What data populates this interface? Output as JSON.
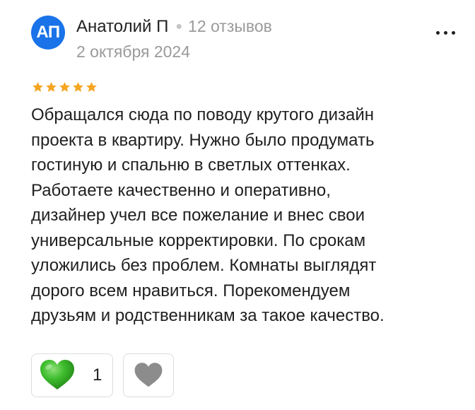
{
  "review": {
    "avatar_initials": "АП",
    "author_name": "Анатолий П",
    "reviews_count": "12 отзывов",
    "date": "2 октября 2024",
    "rating": 5,
    "rating_max": 5,
    "text_lines": [
      "Обращался сюда по поводу крутого дизайн",
      "проекта в квартиру. Нужно было продумать",
      "гостиную и спальню в светлых оттенках.",
      "Работаете качественно и оперативно,",
      "дизайнер учел все пожелание и внес свои",
      "универсальные корректировки. По срокам",
      "уложились без проблем. Комнаты выглядят",
      "дорого всем нравиться. Порекомендуем",
      "друзьям и родственникам за такое качество."
    ],
    "likes": "1"
  },
  "colors": {
    "avatar_bg": "#1a73e8",
    "star": "#f5a623",
    "like_heart": "#3dbb2c",
    "dislike_heart": "#8c8c8c"
  },
  "icons": {
    "more": "more-dots-icon",
    "star": "star-icon",
    "like": "heart-icon",
    "dislike": "heart-outline-icon"
  }
}
